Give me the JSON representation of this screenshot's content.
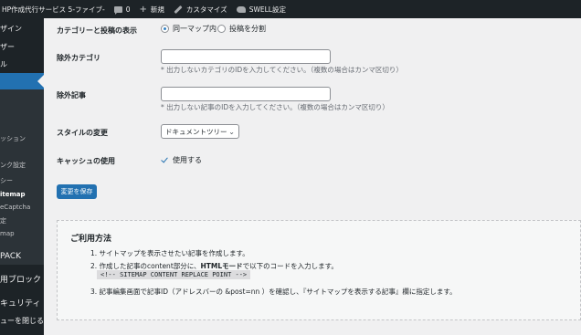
{
  "admin_bar": {
    "site_name": "HP作成代行サービス 5-ファイブ-",
    "comments_count": "0",
    "new_label": "新規",
    "customize_label": "カスタマイズ",
    "swell_label": "SWELL設定"
  },
  "sidebar": {
    "items": [
      {
        "label": "ザイン"
      },
      {
        "label": "ザー"
      },
      {
        "label": "ル"
      },
      {
        "label": ""
      },
      {
        "label": "ッション"
      },
      {
        "label": "ンク設定"
      },
      {
        "label": "シー"
      },
      {
        "label": "itemap"
      },
      {
        "label": "eCaptcha"
      },
      {
        "label": "定"
      },
      {
        "label": "map"
      },
      {
        "label": "PACK"
      },
      {
        "label": "用ブロック"
      },
      {
        "label": "キュリティ"
      },
      {
        "label": "ューを閉じる"
      }
    ]
  },
  "settings": {
    "display_label": "カテゴリーと投稿の表示",
    "option_single": "同一マップ内",
    "option_split": "投稿を分割",
    "exclude_cat_label": "除外カテゴリ",
    "exclude_cat_desc": "* 出力しないカテゴリのIDを入力してください。（複数の場合はカンマ区切り）",
    "exclude_post_label": "除外記事",
    "exclude_post_desc": "* 出力しない記事のIDを入力してください。（複数の場合はカンマ区切り）",
    "style_label": "スタイルの変更",
    "style_value": "ドキュメントツリー",
    "cache_label": "キャッシュの使用",
    "cache_text": "使用する",
    "save_label": "変更を保存"
  },
  "usage": {
    "title": "ご利用方法",
    "step1": "1. サイトマップを表示させたい記事を作成します。",
    "step2_pre": "2. 作成した記事のcontent部分に、",
    "step2_bold": "HTMLモード",
    "step2_post": "で以下のコードを入力します。",
    "code": "<!-- SITEMAP CONTENT REPLACE POINT -->",
    "step3": "3. 記事編集画面で記事ID（アドレスバーの &post=nn ）を確認し、『サイトマップを表示する記事』欄に指定します。"
  },
  "colors": {
    "accent": "#2271b1",
    "sidebar_bg": "#1d2327",
    "content_bg": "#f0f0f1"
  }
}
